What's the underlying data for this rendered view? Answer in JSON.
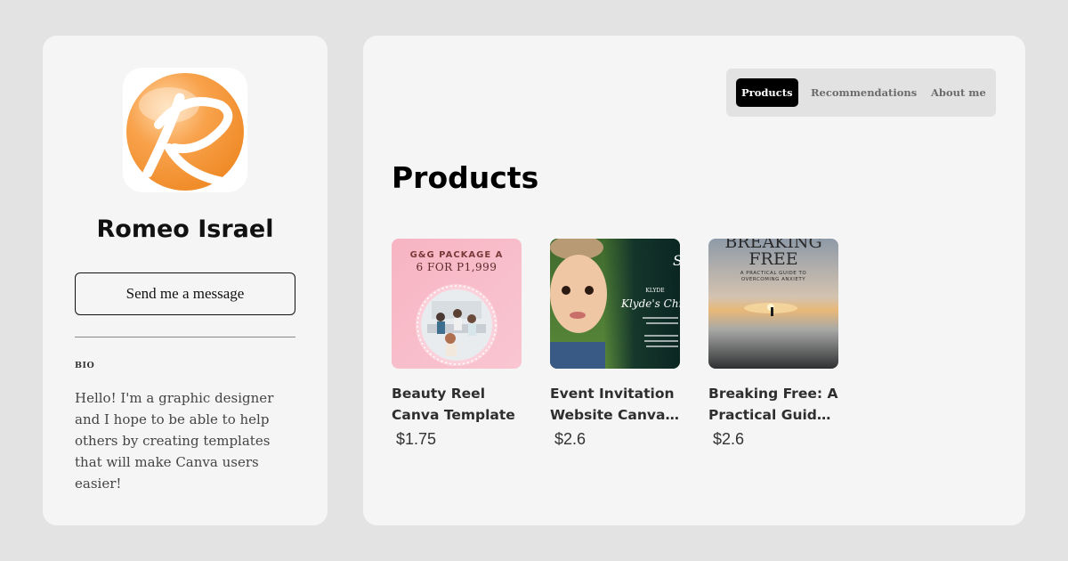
{
  "profile": {
    "name": "Romeo Israel",
    "message_button": "Send me a message",
    "bio_label": "BIO",
    "bio_text": "Hello! I'm a graphic designer and I hope to be able to help others by creating templates that will make Canva users easier!",
    "avatar_icon": "orange-r-logo-icon"
  },
  "tabs": [
    {
      "label": "Products",
      "active": true
    },
    {
      "label": "Recommendations",
      "active": false
    },
    {
      "label": "About me",
      "active": false
    }
  ],
  "section_title": "Products",
  "products": [
    {
      "title_line1": "Beauty Reel",
      "title_line2": "Canva Template",
      "price": "$1.75",
      "thumb_text1": "G&G PACKAGE A",
      "thumb_text2": "6 FOR P1,999"
    },
    {
      "title_line1": "Event Invitation",
      "title_line2": "Website Canva…",
      "price": "$2.6",
      "thumb_text1": "Klyde's Chr",
      "thumb_text2": "KLYDE"
    },
    {
      "title_line1": "Breaking Free: A",
      "title_line2": "Practical Guide T…",
      "price": "$2.6",
      "thumb_text1": "BREAKING",
      "thumb_text2": "FREE",
      "thumb_text3": "A PRACTICAL GUIDE TO",
      "thumb_text4": "OVERCOMING ANXIETY"
    }
  ],
  "colors": {
    "page_bg": "#e3e3e3",
    "card_bg": "#f5f5f5",
    "accent": "#000000",
    "logo_orange": "#f6a04d"
  }
}
